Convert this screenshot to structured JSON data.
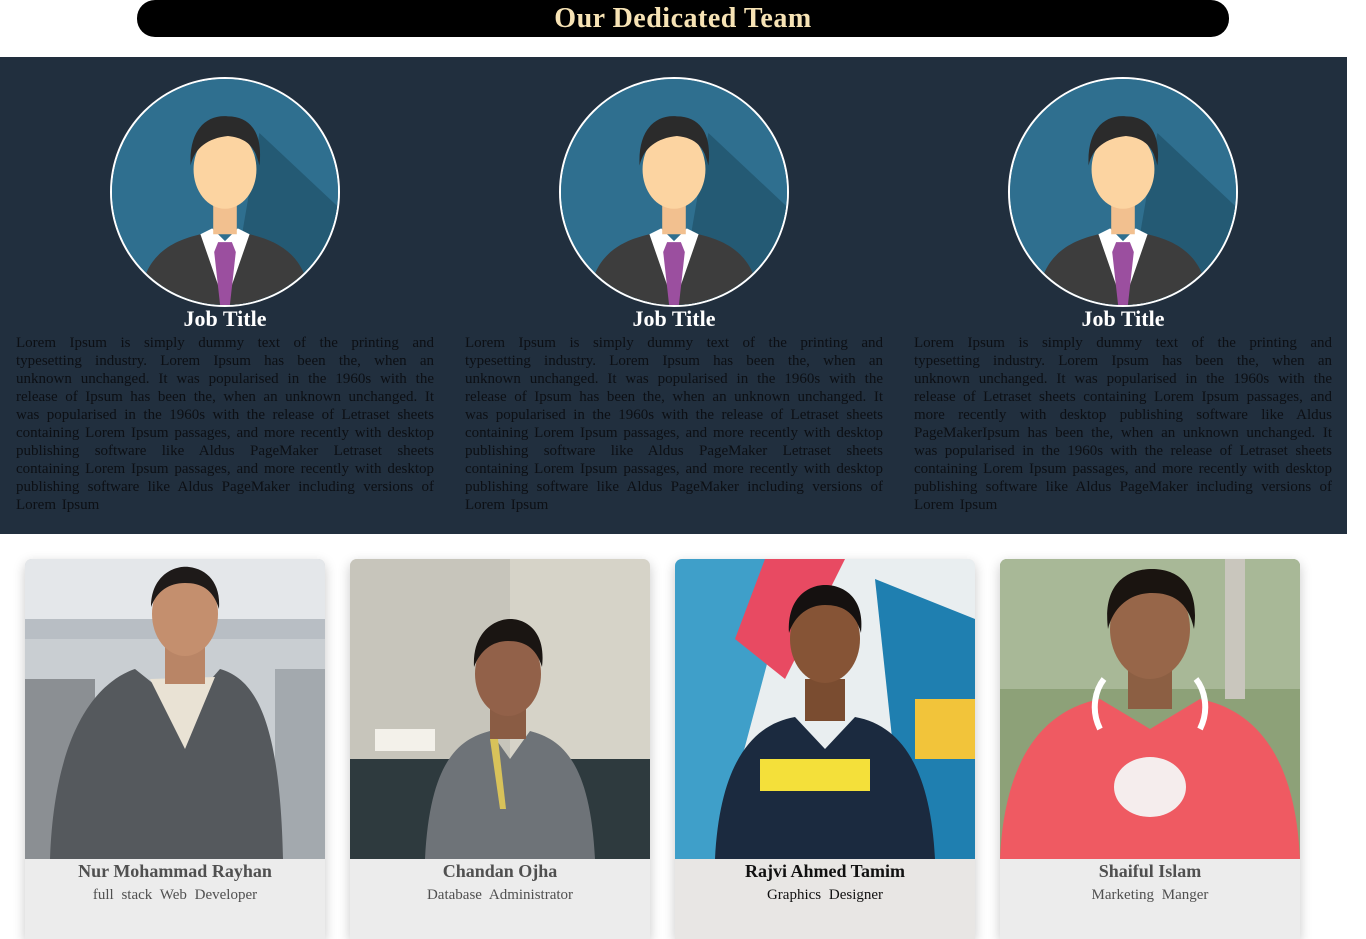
{
  "header": {
    "title": "Our Dedicated Team"
  },
  "jobs": [
    {
      "icon": "businessman-avatar-icon",
      "title": "Job Title",
      "description": "Lorem Ipsum is simply dummy text of the printing and typesetting industry. Lorem Ipsum has been the, when an unknown unchanged. It was popularised in the 1960s with the release of Ipsum has been the, when an unknown unchanged. It was popularised in the 1960s with the release of Letraset sheets containing Lorem Ipsum passages, and more recently with desktop publishing software like Aldus PageMaker Letraset sheets containing Lorem Ipsum passages, and more recently with desktop publishing software like Aldus PageMaker including versions of Lorem Ipsum"
    },
    {
      "icon": "businessman-avatar-icon",
      "title": "Job Title",
      "description": "Lorem Ipsum is simply dummy text of the printing and typesetting industry. Lorem Ipsum has been the, when an unknown unchanged. It was popularised in the 1960s with the release of Ipsum has been the, when an unknown unchanged. It was popularised in the 1960s with the release of Letraset sheets containing Lorem Ipsum passages, and more recently with desktop publishing software like Aldus PageMaker Letraset sheets containing Lorem Ipsum passages, and more recently with desktop publishing software like Aldus PageMaker including versions of Lorem Ipsum"
    },
    {
      "icon": "businessman-avatar-icon",
      "title": "Job Title",
      "description": "Lorem Ipsum is simply dummy text of the printing and typesetting industry. Lorem Ipsum has been the, when an unknown unchanged. It was popularised in the 1960s with the release of Letraset sheets containing Lorem Ipsum passages, and more recently with desktop publishing software like Aldus PageMakerIpsum has been the, when an unknown unchanged. It was popularised in the 1960s with the release of Letraset sheets containing Lorem Ipsum passages, and more recently with desktop publishing software like Aldus PageMaker including versions of Lorem Ipsum"
    }
  ],
  "team": [
    {
      "name": "Nur Mohammad Rayhan",
      "role": "full stack Web Developer"
    },
    {
      "name": "Chandan Ojha",
      "role": "Database Administrator"
    },
    {
      "name": "Rajvi Ahmed Tamim",
      "role": "Graphics Designer"
    },
    {
      "name": "Shaiful Islam",
      "role": "Marketing Manger"
    }
  ],
  "colors": {
    "header_bg": "#000000",
    "header_text": "#f7e3b5",
    "section_bg": "#212f3e",
    "avatar_bg": "#2e6e8e",
    "tie": "#9b4f9f"
  }
}
